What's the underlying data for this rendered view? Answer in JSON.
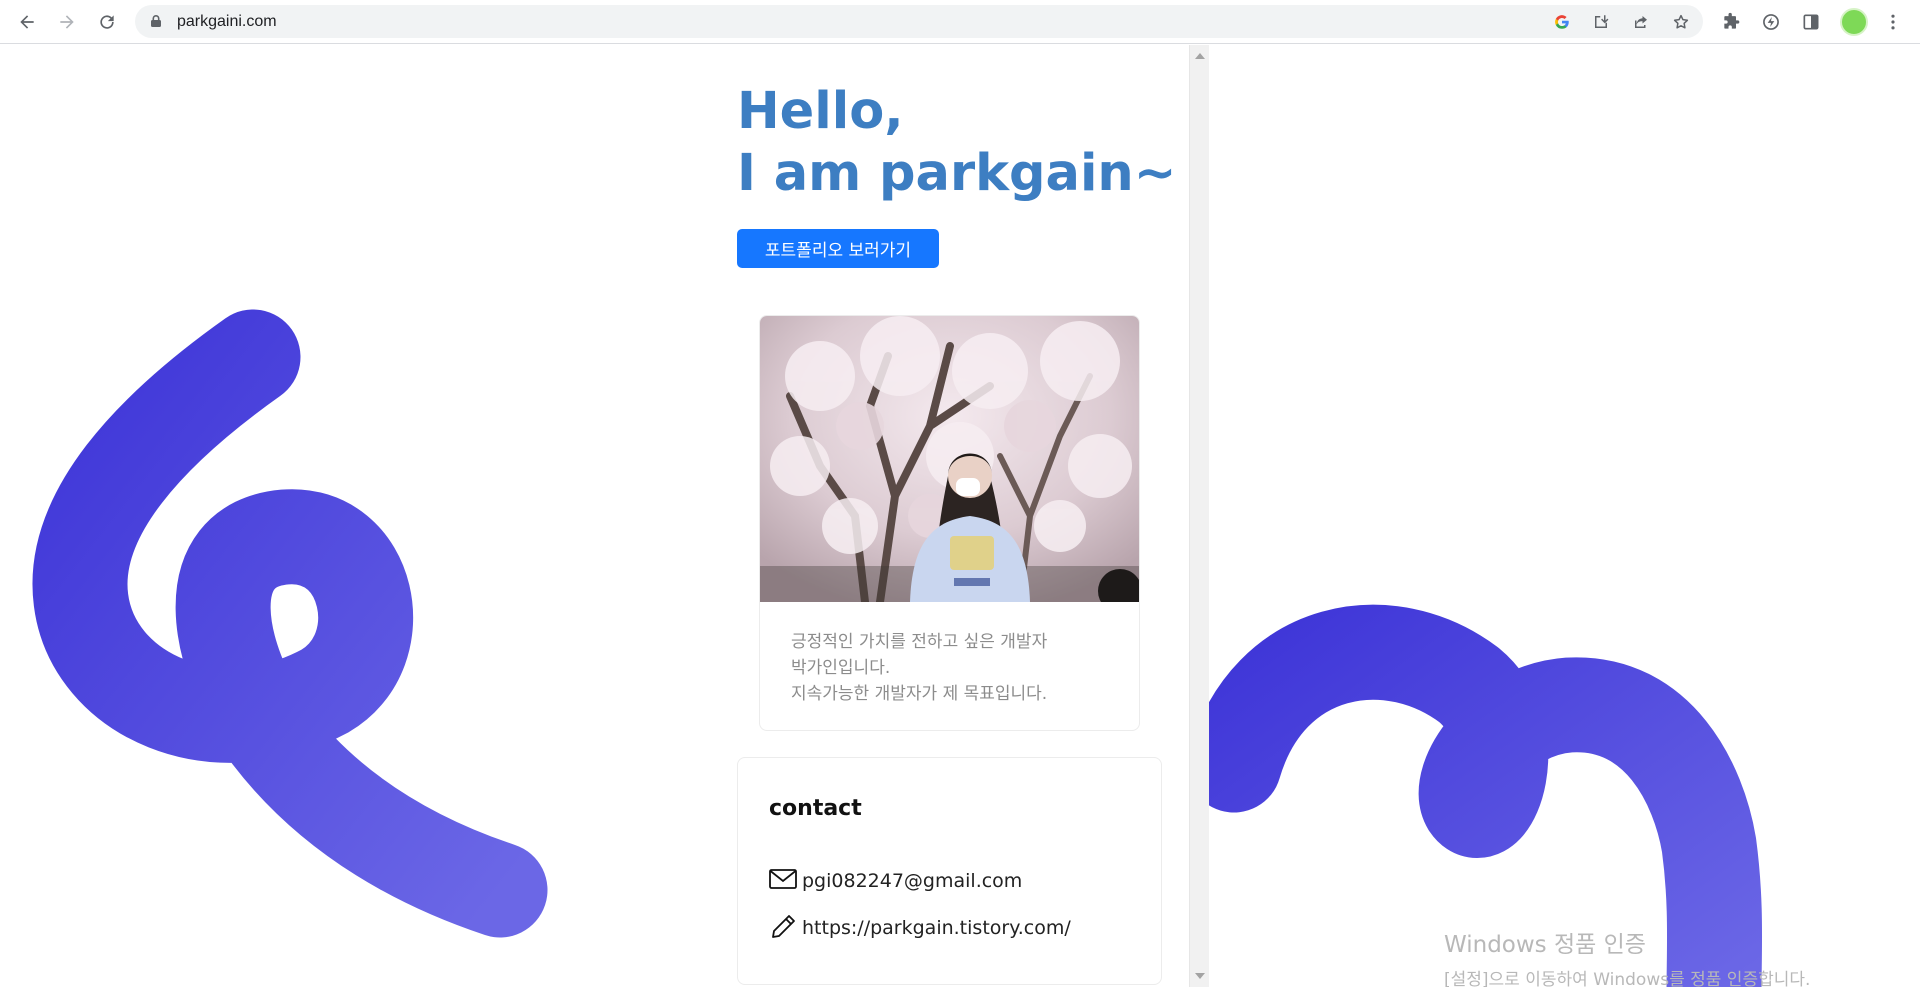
{
  "browser": {
    "url": "parkgaini.com",
    "back_icon": "back-arrow-icon",
    "forward_icon": "forward-arrow-icon",
    "reload_icon": "reload-icon",
    "lock_icon": "lock-icon",
    "omnibox_icons": [
      "google-icon",
      "install-app-icon",
      "share-icon",
      "bookmark-star-icon"
    ],
    "toolbar_icons": [
      "extensions-icon",
      "performance-icon",
      "side-panel-icon",
      "profile-avatar",
      "menu-kebab-icon"
    ]
  },
  "hero": {
    "line1": "Hello,",
    "line2": "I am parkgain~",
    "cta_label": "포트폴리오 보러가기"
  },
  "profile_card": {
    "desc_line1": "긍정적인 가치를 전하고 싶은 개발자",
    "desc_line2": "박가인입니다.",
    "desc_line3": "지속가능한 개발자가 제 목표입니다."
  },
  "contact": {
    "title": "contact",
    "email": "pgi082247@gmail.com",
    "blog": "https://parkgain.tistory.com/",
    "email_icon": "mail-icon",
    "blog_icon": "pencil-icon"
  },
  "watermark": {
    "title": "Windows 정품 인증",
    "subtitle": "[설정]으로 이동하여 Windows를 정품 인증합니다."
  },
  "colors": {
    "accent": "#3d7ec2",
    "button": "#1677ff",
    "squiggle_start": "#3f36d8",
    "squiggle_end": "#6b67e6"
  }
}
